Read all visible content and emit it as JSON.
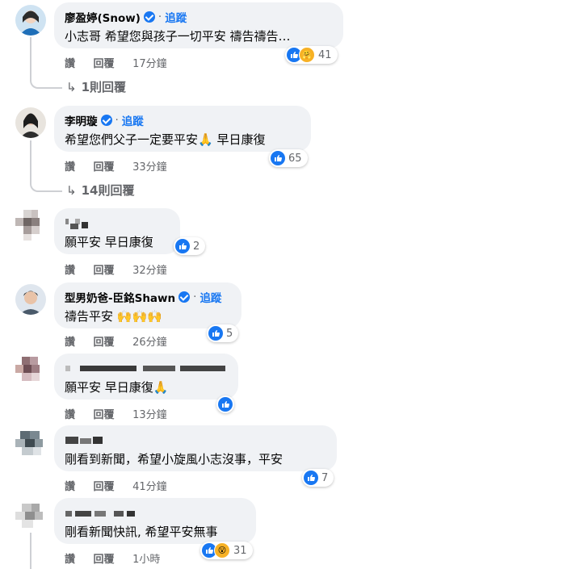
{
  "comments": [
    {
      "name": "廖盈婷(Snow)",
      "verified": true,
      "follow": "追蹤",
      "text": "小志哥 希望您與孩子一切平安 禱告禱告…",
      "like": "讚",
      "reply": "回覆",
      "time": "17分鐘",
      "reactions": "41",
      "replies": "1則回覆"
    },
    {
      "name": "李明璇",
      "verified": true,
      "follow": "追蹤",
      "text": "希望您們父子一定要平安🙏 早日康復",
      "like": "讚",
      "reply": "回覆",
      "time": "33分鐘",
      "reactions": "65",
      "replies": "14則回覆"
    },
    {
      "text": "願平安 早日康復",
      "like": "讚",
      "reply": "回覆",
      "time": "32分鐘",
      "reactions": "2"
    },
    {
      "name": "型男奶爸-臣銘Shawn",
      "verified": true,
      "follow": "追蹤",
      "text": "禱告平安 🙌🙌🙌",
      "like": "讚",
      "reply": "回覆",
      "time": "26分鐘",
      "reactions": "5"
    },
    {
      "text": "願平安 早日康復🙏",
      "like": "讚",
      "reply": "回覆",
      "time": "13分鐘"
    },
    {
      "text": "剛看到新聞，希望小旋風小志沒事，平安",
      "like": "讚",
      "reply": "回覆",
      "time": "41分鐘",
      "reactions": "7"
    },
    {
      "text": "剛看新聞快訊, 希望平安無事",
      "like": "讚",
      "reply": "回覆",
      "time": "1小時",
      "reactions": "31"
    }
  ],
  "separator": "·",
  "colors": {
    "accent": "#1877f2",
    "bubble": "#f0f2f5",
    "meta": "#65676b"
  },
  "icons": [
    "verified-badge-icon",
    "reply-arrow-icon",
    "like-reaction-icon",
    "care-reaction-icon",
    "wow-reaction-icon"
  ]
}
